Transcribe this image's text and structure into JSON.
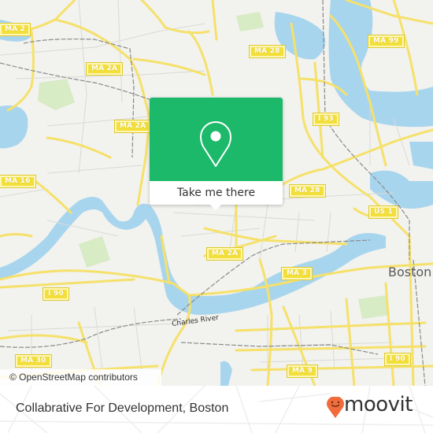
{
  "map": {
    "route_shields": [
      {
        "id": "ma2-topleft",
        "label": "MA 2"
      },
      {
        "id": "ma2a-upper",
        "label": "MA 2A"
      },
      {
        "id": "ma2a-mid",
        "label": "MA 2A"
      },
      {
        "id": "ma2a-lower",
        "label": "MA 2A"
      },
      {
        "id": "ma28-top",
        "label": "MA 28"
      },
      {
        "id": "ma28-right",
        "label": "MA 28"
      },
      {
        "id": "ma99",
        "label": "MA 99"
      },
      {
        "id": "i93",
        "label": "I 93"
      },
      {
        "id": "ma16",
        "label": "MA 16"
      },
      {
        "id": "us1",
        "label": "US 1"
      },
      {
        "id": "ma3",
        "label": "MA 3"
      },
      {
        "id": "i90-left",
        "label": "I 90"
      },
      {
        "id": "i90-right",
        "label": "I 90"
      },
      {
        "id": "ma30",
        "label": "MA 30"
      },
      {
        "id": "ma9",
        "label": "MA 9"
      }
    ],
    "place_labels": {
      "city": "Boston",
      "river": "Charles River"
    },
    "colors": {
      "land": "#f2f2ef",
      "water": "#a8d5ee",
      "road_major": "#f5e16a",
      "road_minor": "#d9d9d4",
      "rail": "#8a8a8a",
      "park": "#d7ebc4"
    },
    "attribution": "© OpenStreetMap contributors"
  },
  "popup": {
    "button_label": "Take me there",
    "icon": "map-pin-icon",
    "color": "#1db96a"
  },
  "footer": {
    "place_name": "Collabrative For Development, Boston",
    "brand": "moovit",
    "brand_color": "#f26b3a"
  }
}
